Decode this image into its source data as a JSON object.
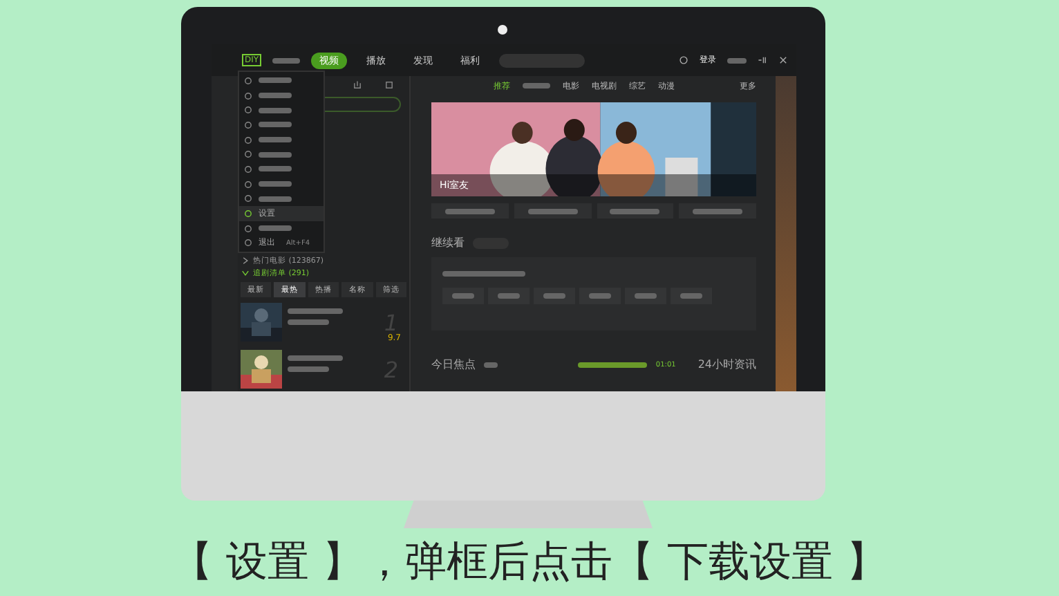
{
  "screen": {
    "top_bar": {
      "logo": "DIY",
      "nav": [
        {
          "label": "视频",
          "selected": true
        },
        {
          "label": "播放",
          "selected": false
        },
        {
          "label": "发现",
          "selected": false
        },
        {
          "label": "福利",
          "selected": false
        }
      ],
      "login": "登录"
    },
    "menu": [
      {
        "selected": false
      },
      {
        "selected": false
      },
      {
        "selected": false
      },
      {
        "selected": false
      },
      {
        "selected": false
      },
      {
        "selected": false
      },
      {
        "selected": false
      },
      {
        "selected": false
      },
      {
        "selected": false
      },
      {
        "label": "设置",
        "selected": true
      },
      {
        "selected": false
      },
      {
        "label": "退出",
        "shortcut": "Alt+F4",
        "selected": false
      }
    ],
    "sidebar": {
      "groups": [
        {
          "label": "热门电影",
          "count": "(123867)",
          "expanded": false
        },
        {
          "label": "追剧清单",
          "count": "(291)",
          "expanded": true
        }
      ],
      "filters": [
        {
          "label": "最新",
          "selected": false
        },
        {
          "label": "最热",
          "selected": true
        },
        {
          "label": "热播",
          "selected": false
        },
        {
          "label": "名称",
          "selected": false
        },
        {
          "label": "筛选",
          "selected": false
        }
      ],
      "items": [
        {
          "rank": "1",
          "score": "9.7"
        },
        {
          "rank": "2"
        }
      ]
    },
    "category_tabs": [
      {
        "label": "推荐",
        "selected": true
      },
      {
        "selected": false
      },
      {
        "label": "电影",
        "selected": false
      },
      {
        "label": "电视剧",
        "selected": false
      },
      {
        "label": "综艺",
        "selected": false
      },
      {
        "label": "动漫",
        "selected": false
      }
    ],
    "more": "更多",
    "banner": {
      "title": "Hi室友"
    },
    "continue_title": "继续看",
    "focus_title": "今日焦点",
    "focus_time": "01:01",
    "news_title": "24小时资讯"
  },
  "caption": "【 设置 】，弹框后点击【 下载设置 】"
}
